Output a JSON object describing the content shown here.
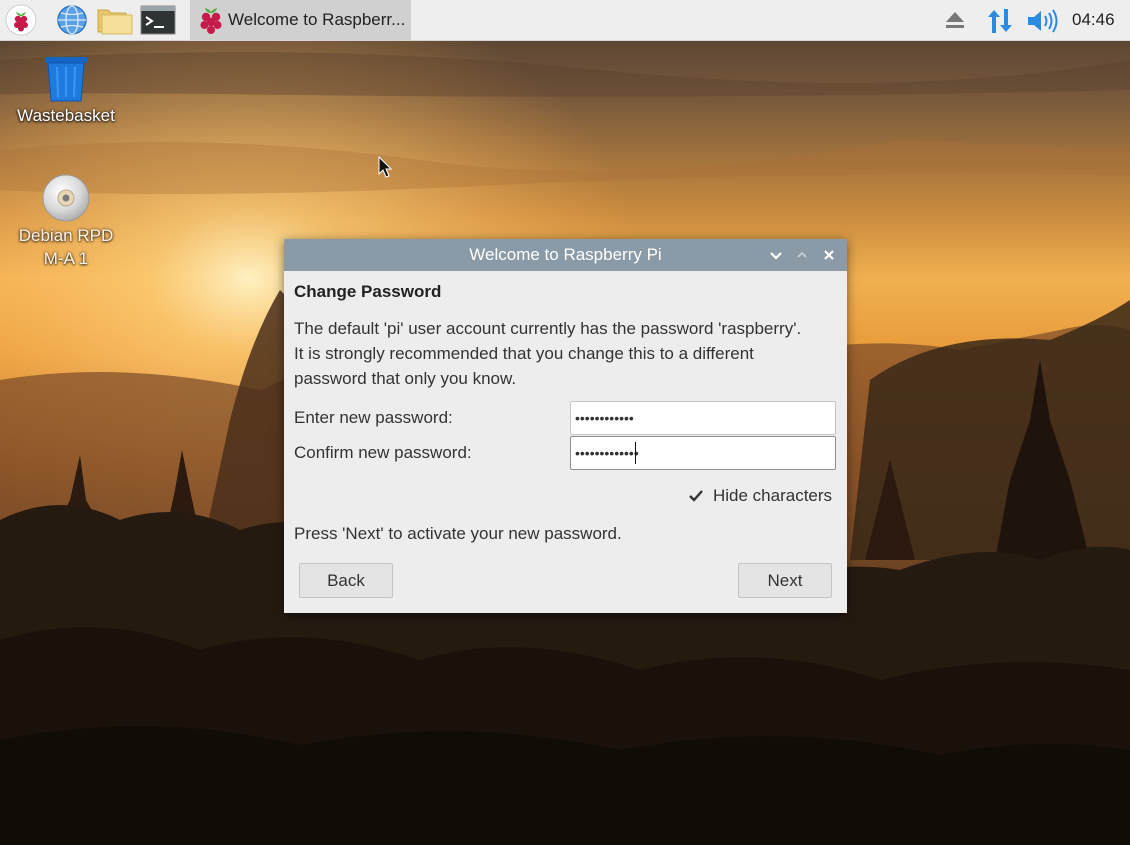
{
  "taskbar": {
    "task_title": "Welcome to Raspberr...",
    "clock": "04:46"
  },
  "desktop": {
    "icons": [
      {
        "label": "Wastebasket",
        "icon": "wastebasket-icon"
      },
      {
        "label": "Debian RPD\nM-A 1",
        "icon": "cd-drive-icon"
      }
    ]
  },
  "dialog": {
    "title": "Welcome to Raspberry Pi",
    "heading": "Change Password",
    "description_lines": [
      "The default 'pi' user account currently has the password 'raspberry'.",
      "It is strongly recommended that you change this to a different",
      "password that only you know."
    ],
    "new_password_label": "Enter new password:",
    "new_password_value": "••••••••••••",
    "confirm_password_label": "Confirm new password:",
    "confirm_password_value": "•••••••••••••",
    "hide_characters_label": "Hide characters",
    "hide_characters_checked": true,
    "hint": "Press 'Next' to activate your new password.",
    "back_label": "Back",
    "next_label": "Next"
  },
  "colors": {
    "titlebar": "#8a9aa6",
    "dialog_bg": "#ededed",
    "taskbar_bg": "#eeeeee",
    "raspberry": "#c51a4a",
    "accent_blue": "#2a8be0"
  }
}
